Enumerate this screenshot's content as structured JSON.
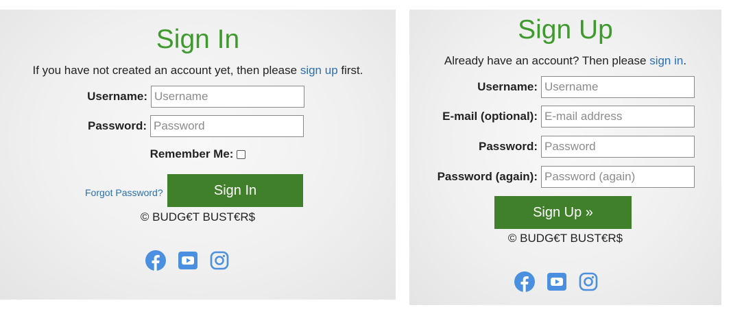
{
  "signin": {
    "title": "Sign In",
    "intro_before": "If you have not created an account yet, then please ",
    "intro_link": "sign up",
    "intro_after": " first.",
    "username_label": "Username:",
    "username_placeholder": "Username",
    "password_label": "Password:",
    "password_placeholder": "Password",
    "remember_label": "Remember Me:",
    "forgot_link": "Forgot Password?",
    "submit_label": "Sign In",
    "copyright": "© BUDG€T BUST€R$"
  },
  "signup": {
    "title": "Sign Up",
    "intro_before": "Already have an account? Then please ",
    "intro_link": "sign in",
    "intro_after": ".",
    "username_label": "Username:",
    "username_placeholder": "Username",
    "email_label": "E-mail (optional):",
    "email_placeholder": "E-mail address",
    "password_label": "Password:",
    "password_placeholder": "Password",
    "password2_label": "Password (again):",
    "password2_placeholder": "Password (again)",
    "submit_label": "Sign Up »",
    "copyright": "© BUDG€T BUST€R$"
  },
  "social_icons": [
    "facebook-icon",
    "youtube-icon",
    "instagram-icon"
  ],
  "colors": {
    "title_green": "#3f9a2e",
    "button_green": "#40802a",
    "link_blue": "#2a6fb5",
    "icon_blue": "#4a8fe0"
  }
}
